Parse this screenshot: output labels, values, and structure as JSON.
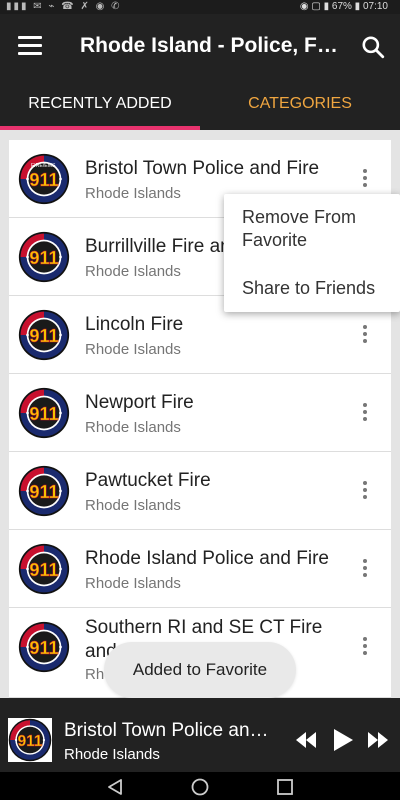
{
  "status_bar": {
    "left": "▮▮▮ ✉ ⌁ ☎ ✗ ◉ ✆",
    "right": "◉ ▢ ▮ 67% ▮ 07:10"
  },
  "app_bar": {
    "title": "Rhode Island - Police, Fire & EMS",
    "menu_icon": "hamburger-menu-icon",
    "search_icon": "search-icon"
  },
  "tabs": [
    {
      "label": "RECENTLY ADDED",
      "active": true
    },
    {
      "label": "CATEGORIES",
      "active": false
    }
  ],
  "colors": {
    "tab_indicator": "#e8336e",
    "inactive_tab": "#f0a640",
    "app_bar": "#222222"
  },
  "logo": {
    "badge_number": "911",
    "ring_left": "FIRE/EMS",
    "ring_right": "POLICE",
    "ring_bottom": "DISPATCH"
  },
  "stations": [
    {
      "title": "Bristol Town Police and Fire",
      "subtitle": "Rhode Islands"
    },
    {
      "title": "Burrillville Fire and EMS",
      "subtitle": "Rhode Islands"
    },
    {
      "title": "Lincoln Fire",
      "subtitle": "Rhode Islands"
    },
    {
      "title": "Newport Fire",
      "subtitle": "Rhode Islands"
    },
    {
      "title": "Pawtucket Fire",
      "subtitle": "Rhode Islands"
    },
    {
      "title": "Rhode Island Police and Fire",
      "subtitle": "Rhode Islands"
    },
    {
      "title": "Southern RI and SE CT Fire and EMS",
      "subtitle": "Rhode Islands"
    }
  ],
  "popup_menu": [
    "Remove From Favorite",
    "Share to Friends"
  ],
  "toast": "Added to Favorite",
  "player": {
    "title": "Bristol Town Police and Fire",
    "subtitle": "Rhode Islands"
  }
}
